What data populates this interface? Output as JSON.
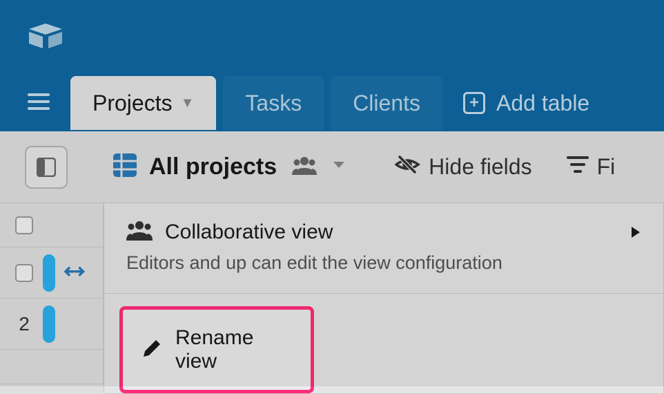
{
  "tabs": {
    "projects": "Projects",
    "tasks": "Tasks",
    "clients": "Clients",
    "add_table": "Add table"
  },
  "toolbar": {
    "view_name": "All projects",
    "hide_fields": "Hide fields",
    "filter": "Fi"
  },
  "rows": {
    "r2": "2"
  },
  "menu": {
    "collab_title": "Collaborative view",
    "collab_desc": "Editors and up can edit the view configuration",
    "rename": "Rename view"
  }
}
